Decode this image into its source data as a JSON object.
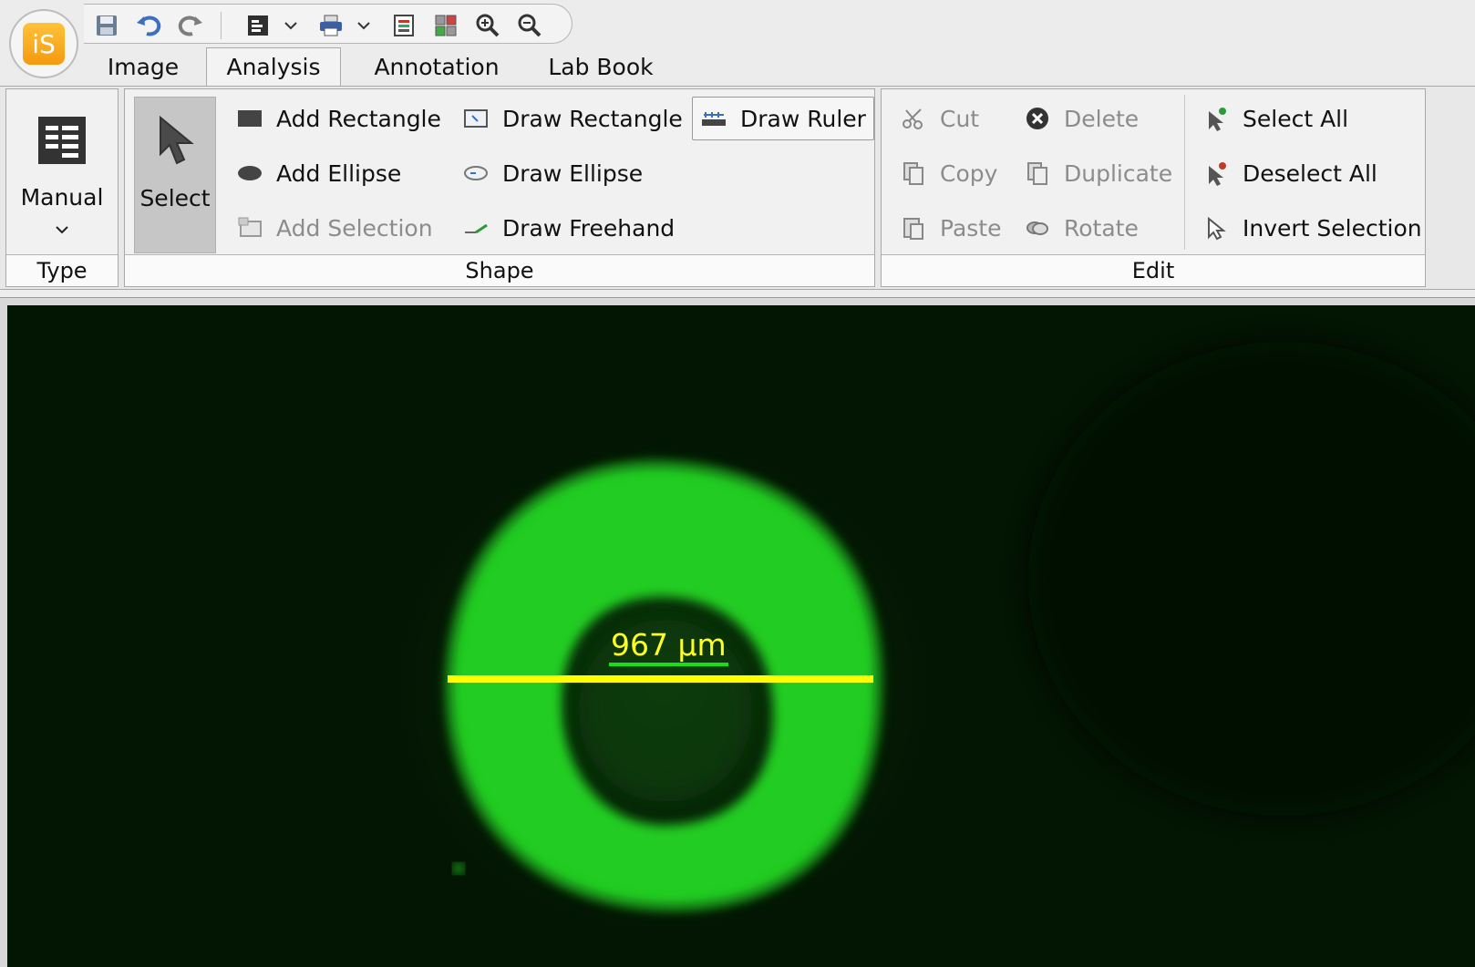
{
  "app": {
    "logo_text": "iS"
  },
  "quick_access": {
    "icons": [
      "save-icon",
      "undo-icon",
      "redo-icon",
      "layout-icon",
      "print-icon",
      "report-icon",
      "grid-icon",
      "zoom-in-icon",
      "zoom-out-icon"
    ]
  },
  "tabs": [
    {
      "label": "Image"
    },
    {
      "label": "Analysis",
      "active": true
    },
    {
      "label": "Annotation"
    },
    {
      "label": "Lab Book"
    }
  ],
  "ribbon": {
    "type_group": {
      "button_label": "Manual",
      "label": "Type"
    },
    "shape_group": {
      "label": "Shape",
      "select_label": "Select",
      "add_rectangle": "Add Rectangle",
      "add_ellipse": "Add Ellipse",
      "add_selection": "Add Selection",
      "draw_rectangle": "Draw Rectangle",
      "draw_ellipse": "Draw Ellipse",
      "draw_freehand": "Draw Freehand",
      "draw_ruler": "Draw Ruler"
    },
    "edit_group": {
      "label": "Edit",
      "cut": "Cut",
      "copy": "Copy",
      "paste": "Paste",
      "delete": "Delete",
      "duplicate": "Duplicate",
      "rotate": "Rotate",
      "select_all": "Select All",
      "deselect_all": "Deselect All",
      "invert_selection": "Invert Selection"
    }
  },
  "canvas": {
    "measurement_label": "967 µm",
    "ruler_color": "#ffff00",
    "fluorescence_color": "#22cc22"
  }
}
